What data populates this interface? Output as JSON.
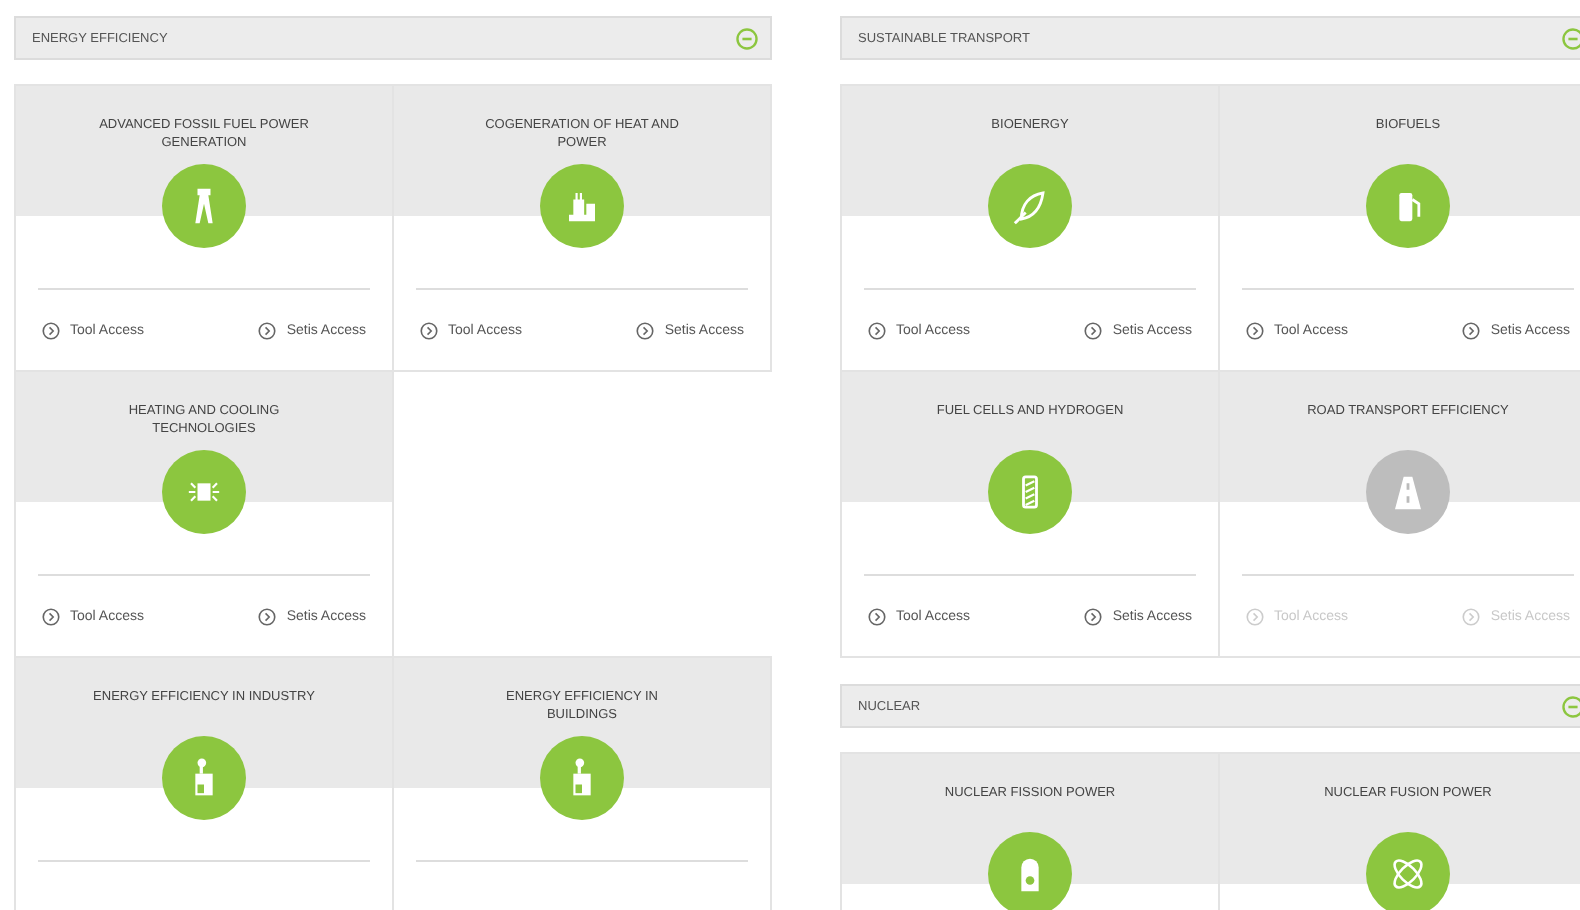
{
  "columns": [
    {
      "sections": [
        {
          "title": "ENERGY EFFICIENCY",
          "expanded": true,
          "cards": [
            {
              "title": "ADVANCED FOSSIL FUEL POWER GENERATION",
              "disabled": false,
              "links": [
                "Tool Access",
                "Setis Access"
              ]
            },
            {
              "title": "COGENERATION OF HEAT AND POWER",
              "disabled": false,
              "links": [
                "Tool Access",
                "Setis Access"
              ]
            },
            {
              "title": "HEATING AND COOLING TECHNOLOGIES",
              "disabled": false,
              "links": [
                "Tool Access",
                "Setis Access"
              ]
            },
            {
              "kind": "empty"
            },
            {
              "title": "ENERGY EFFICIENCY IN INDUSTRY",
              "disabled": false
            },
            {
              "title": "ENERGY EFFICIENCY IN BUILDINGS",
              "disabled": false
            }
          ]
        }
      ]
    },
    {
      "sections": [
        {
          "title": "SUSTAINABLE TRANSPORT",
          "expanded": true,
          "cards": [
            {
              "title": "BIOENERGY",
              "disabled": false,
              "links": [
                "Tool Access",
                "Setis Access"
              ]
            },
            {
              "title": "BIOFUELS",
              "disabled": false,
              "links": [
                "Tool Access",
                "Setis Access"
              ]
            },
            {
              "title": "FUEL CELLS AND HYDROGEN",
              "disabled": false,
              "links": [
                "Tool Access",
                "Setis Access"
              ]
            },
            {
              "title": "ROAD TRANSPORT EFFICIENCY",
              "disabled": true,
              "links": [
                "Tool Access",
                "Setis Access"
              ]
            }
          ]
        },
        {
          "title": "NUCLEAR",
          "expanded": true,
          "cards": [
            {
              "title": "NUCLEAR FISSION POWER",
              "disabled": false
            },
            {
              "title": "NUCLEAR FUSION POWER",
              "disabled": false
            }
          ]
        }
      ]
    }
  ]
}
